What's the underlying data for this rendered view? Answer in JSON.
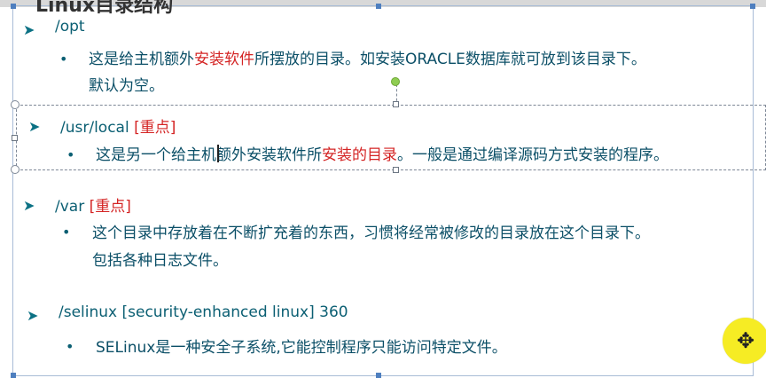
{
  "slide": {
    "title": "Linux目录结构",
    "sections": [
      {
        "head": "/opt",
        "line1": "这是给主机额外",
        "line1_red": "安装软件",
        "line1_tail": "所摆放的目录。如安装ORACLE数据库就可放到该目录下。",
        "line2": "默认为空。"
      },
      {
        "head": "/usr/local",
        "tag": "[重点]",
        "line1": "这是另一个给主机额外安装软件所",
        "line1_red": "安装的目录",
        "line1_tail": "。一般是通过编译源码方式安装的程序。"
      },
      {
        "head": "/var",
        "tag": "[重点]",
        "line1": "这个目录中存放着在不断扩充着的东西，习惯将经常被修改的目录放在这个目录下。",
        "line2": "包括各种日志文件。"
      },
      {
        "head": "/selinux [security-enhanced linux] 360",
        "line1": "SELinux是一种安全子系统,它能控制程序只能访问特定文件。"
      }
    ]
  },
  "icons": {
    "bullet_arrow": "arrowhead-icon",
    "move": "move-icon"
  },
  "colors": {
    "teal": "#0b5f73",
    "red": "#d42424",
    "highlight": "#f6ec24"
  }
}
